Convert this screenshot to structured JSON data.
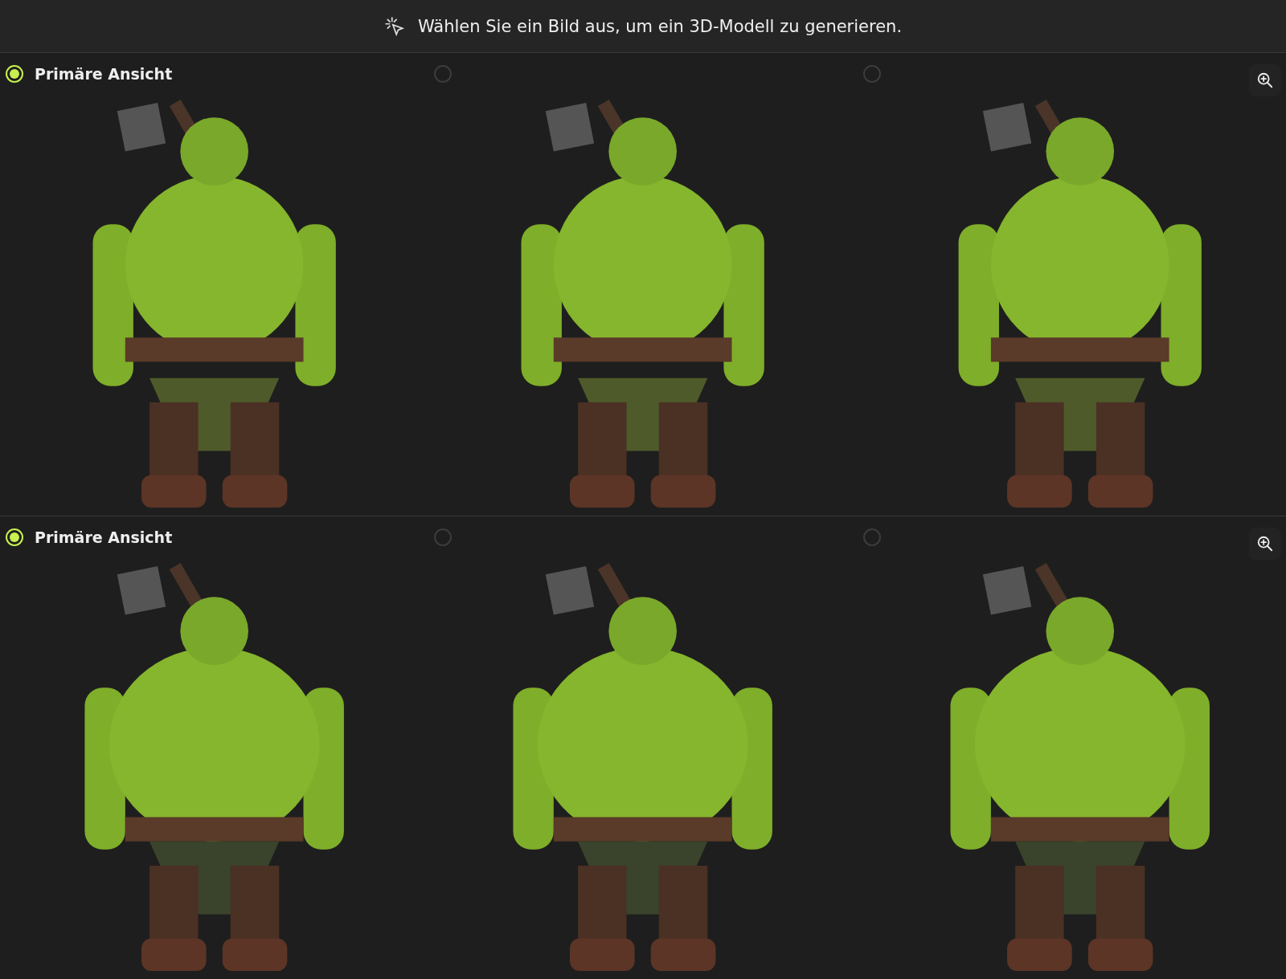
{
  "header": {
    "text": "Wählen Sie ein Bild aus, um ein 3D-Modell zu generieren."
  },
  "rows": [
    {
      "views": [
        {
          "label": "Primäre Ansicht",
          "selected": true
        },
        {
          "selected": false
        },
        {
          "selected": false
        }
      ]
    },
    {
      "views": [
        {
          "label": "Primäre Ansicht",
          "selected": true
        },
        {
          "selected": false
        },
        {
          "selected": false
        }
      ]
    }
  ]
}
